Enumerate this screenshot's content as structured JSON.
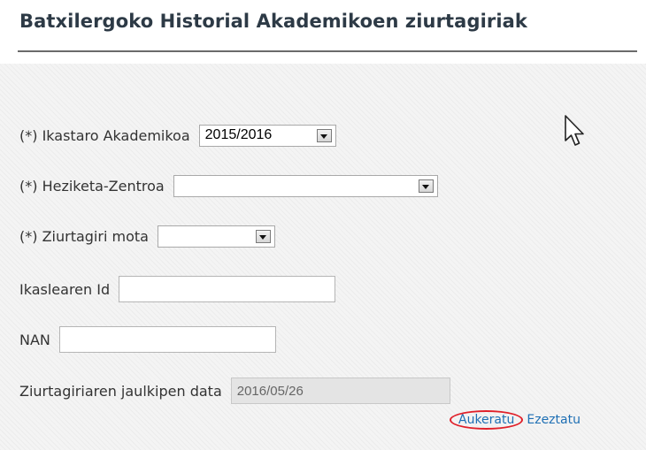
{
  "page": {
    "title": "Batxilergoko Historial Akademikoen ziurtagiriak"
  },
  "form": {
    "academic_year": {
      "label": "(*) Ikastaro Akademikoa",
      "selected": "2015/2016"
    },
    "education_center": {
      "label": "(*) Heziketa-Zentroa",
      "selected": ""
    },
    "certificate_type": {
      "label": "(*) Ziurtagiri mota",
      "selected": ""
    },
    "student_id": {
      "label": "Ikaslearen Id",
      "value": ""
    },
    "nan": {
      "label": "NAN",
      "value": ""
    },
    "issue_date": {
      "label": "Ziurtagiriaren jaulkipen data",
      "value": "2016/05/26"
    }
  },
  "actions": {
    "select_label": "Aukeratu",
    "cancel_label": "Ezeztatu"
  },
  "colors": {
    "title": "#2d3a46",
    "link": "#1e6fb4",
    "highlight": "#e0202a"
  },
  "icons": {
    "cursor": "mouse-pointer-icon",
    "dropdown": "chevron-down-icon"
  }
}
